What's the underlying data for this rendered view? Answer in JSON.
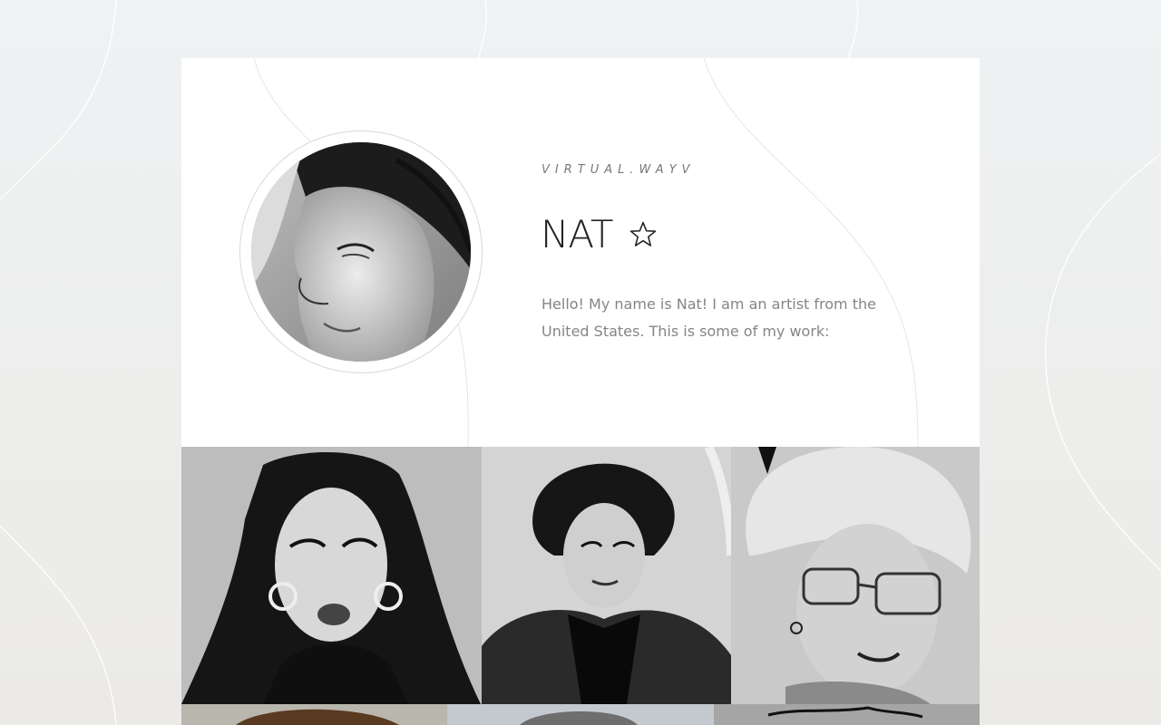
{
  "profile": {
    "handle": "VIRTUAL.WAYV",
    "name": "NAT",
    "name_icon": "star-outline-icon",
    "bio": "Hello! My name is Nat! I am an artist from the United States. This is some of my work:",
    "avatar_icon": "avatar-portrait-sketch"
  },
  "gallery": {
    "items": [
      {
        "icon": "artwork-portrait-hoop-earrings"
      },
      {
        "icon": "artwork-portrait-fur-coat"
      },
      {
        "icon": "artwork-portrait-glasses-afro"
      },
      {
        "icon": "artwork-partial-1"
      },
      {
        "icon": "artwork-partial-2"
      },
      {
        "icon": "artwork-partial-3"
      }
    ]
  },
  "colors": {
    "page_bg": "#eef2f4",
    "card_bg": "#ffffff",
    "text_primary": "#222222",
    "text_muted": "#858585"
  }
}
